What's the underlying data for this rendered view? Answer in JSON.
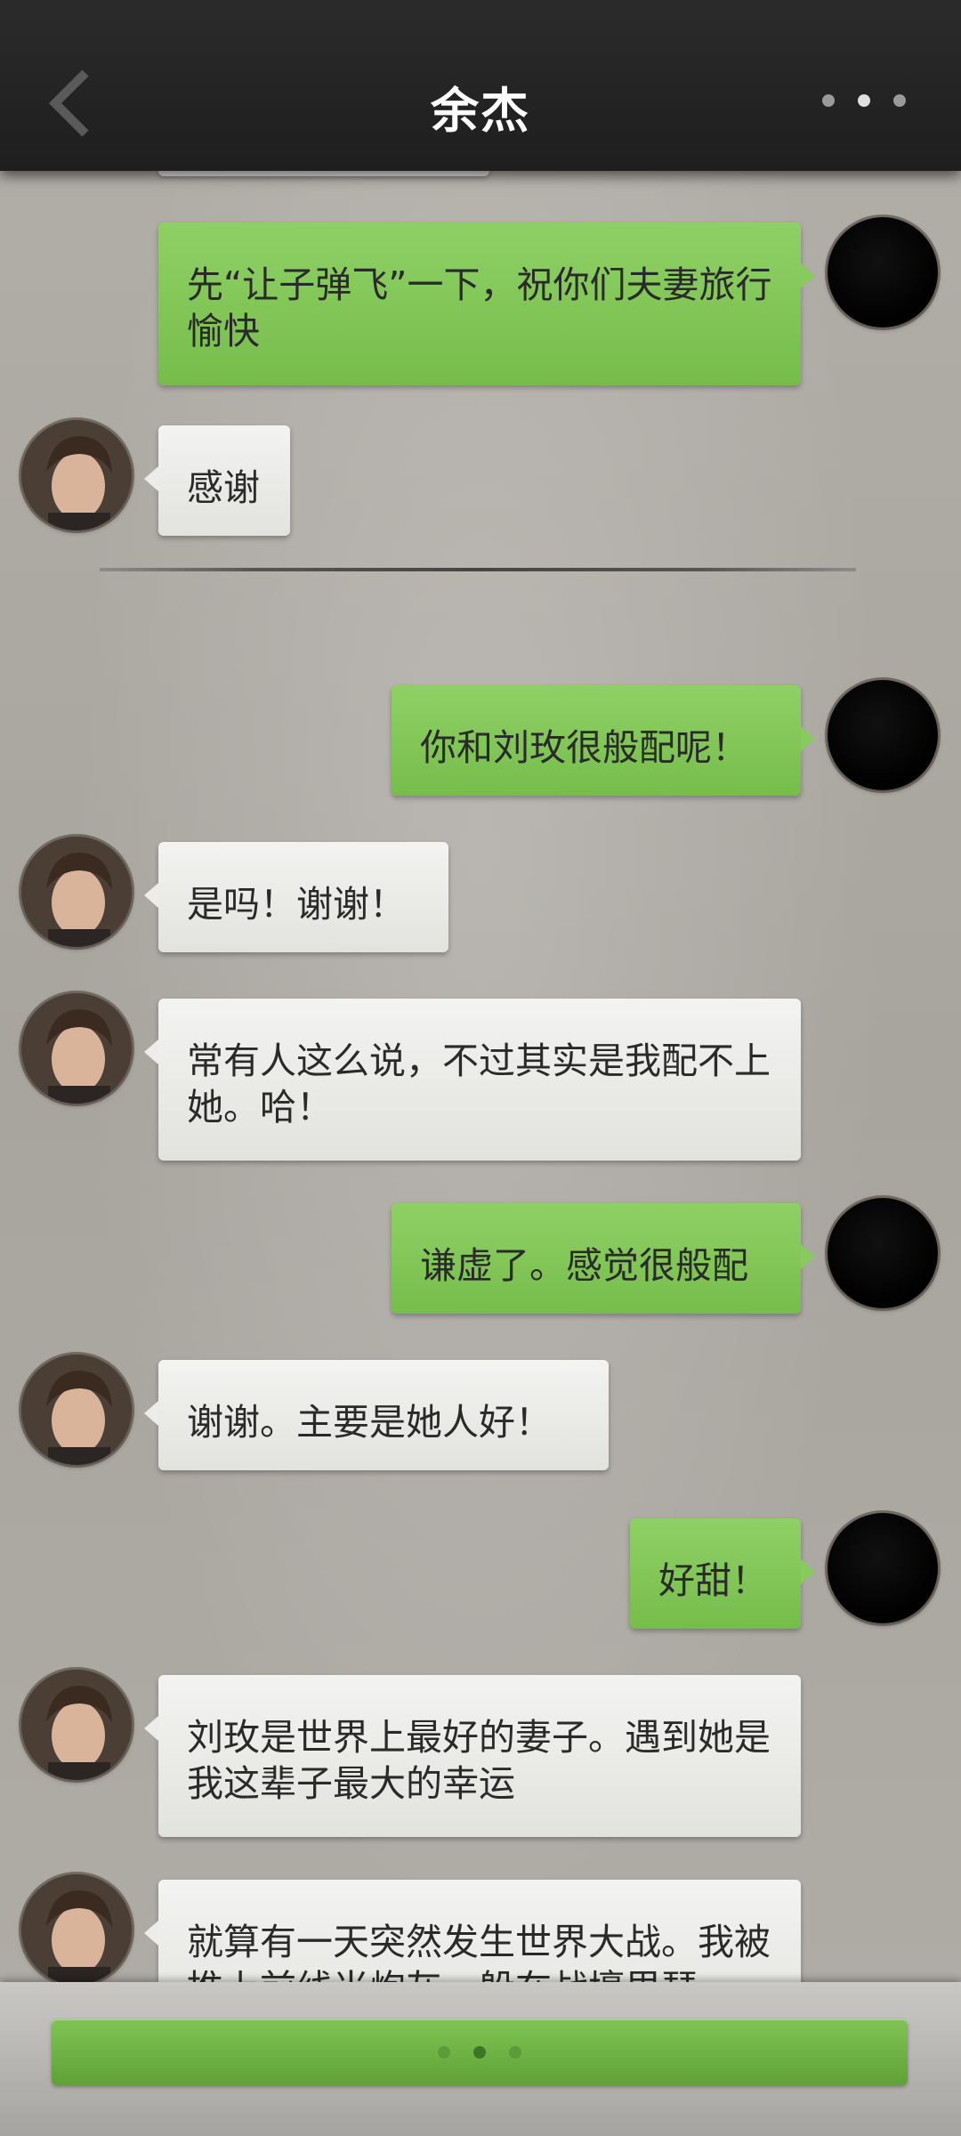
{
  "header": {
    "title": "余杰",
    "back_icon": "chevron-left-icon",
    "more_icon": "more-dots-icon"
  },
  "messages": [
    {
      "from": "me",
      "text": "先“让子弹飞”一下，祝你们夫妻旅行愉快"
    },
    {
      "from": "them",
      "text": "感谢"
    },
    {
      "from": "me",
      "text": "你和刘玫很般配呢！"
    },
    {
      "from": "them",
      "text": "是吗！谢谢！"
    },
    {
      "from": "them",
      "text": "常有人这么说，不过其实是我配不上她。哈！"
    },
    {
      "from": "me",
      "text": "谦虚了。感觉很般配"
    },
    {
      "from": "them",
      "text": "谢谢。主要是她人好！"
    },
    {
      "from": "me",
      "text": "好甜！"
    },
    {
      "from": "them",
      "text": "刘玫是世界上最好的妻子。遇到她是我这辈子最大的幸运"
    },
    {
      "from": "them",
      "text": "就算有一天突然发生世界大战。我被推上前线当炮灰，躲在战壕里瑟"
    }
  ],
  "bottom_bar": {
    "reply_button_icon": "typing-dots-icon"
  },
  "colors": {
    "outgoing_bubble": "#88ca5e",
    "incoming_bubble": "#ececea",
    "header": "#232323",
    "background": "#aaa6a0"
  }
}
